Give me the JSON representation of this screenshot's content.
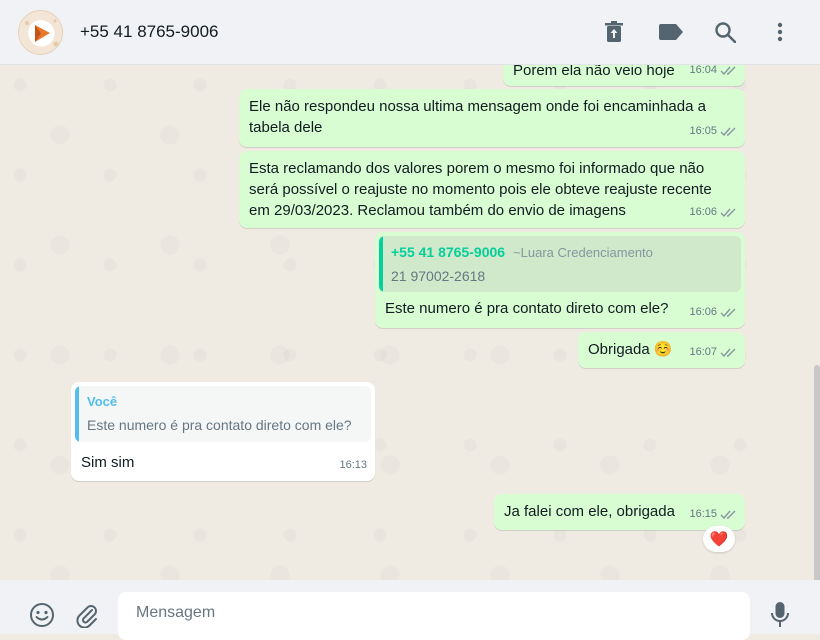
{
  "header": {
    "contact_name": "+55 41 8765-9006",
    "icons": [
      "delete-icon",
      "label-icon",
      "search-icon",
      "menu-icon"
    ]
  },
  "messages": [
    {
      "type": "out",
      "text": "Porem ela não veio hoje",
      "time": "16:04"
    },
    {
      "type": "out",
      "text_line1": "Ele não respondeu nossa ultima mensagem onde foi encaminhada a",
      "text_line2": "tabela dele",
      "time": "16:05"
    },
    {
      "type": "out",
      "text_line1": "Esta reclamando dos valores porem o mesmo foi informado que não",
      "text_line2": "será possível o reajuste no momento pois ele obteve reajuste recente",
      "text_line3": "em 29/03/2023. Reclamou também do envio de imagens",
      "time": "16:06"
    },
    {
      "type": "out",
      "quote_author": "+55 41 8765-9006",
      "quote_sub": "~Luara Credenciamento",
      "quote_text": "21 97002-2618",
      "text": "Este numero é pra contato direto com ele?",
      "time": "16:06"
    },
    {
      "type": "out",
      "text": "Obrigada",
      "emoji": "☺️",
      "time": "16:07"
    },
    {
      "type": "in",
      "quote_author": "Você",
      "quote_text": "Este numero é pra contato direto com ele?",
      "text": "Sim sim",
      "time": "16:13"
    },
    {
      "type": "out",
      "text": "Ja falei com ele, obrigada",
      "time": "16:15",
      "reaction": "❤️"
    }
  ],
  "composer": {
    "placeholder": "Mensagem",
    "icons": [
      "emoji-icon",
      "attach-icon",
      "mic-icon"
    ]
  },
  "colors": {
    "outgoing_bubble": "#d9fdd3",
    "incoming_bubble": "#ffffff",
    "quote_out_accent": "#06cf9c",
    "quote_in_accent": "#53bdeb",
    "chat_bg": "#efeae2",
    "header_bg": "#f0f2f5"
  }
}
